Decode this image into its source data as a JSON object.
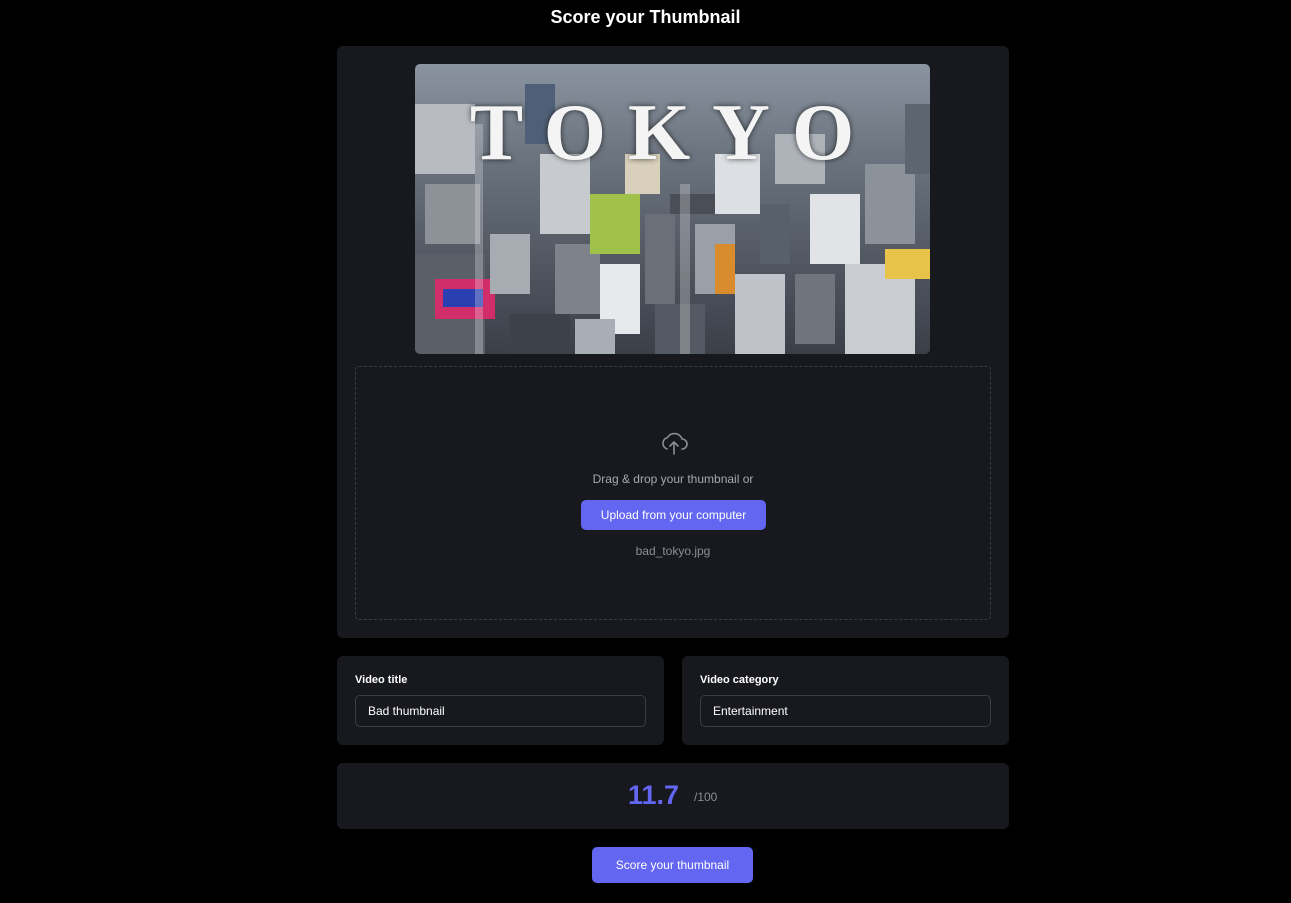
{
  "page": {
    "title": "Score your Thumbnail"
  },
  "thumbnail": {
    "overlay_text": "TOKYO"
  },
  "upload": {
    "drop_text": "Drag & drop your thumbnail or",
    "button_label": "Upload from your computer",
    "file_name": "bad_tokyo.jpg",
    "icon": "cloud-upload-icon"
  },
  "video_title": {
    "label": "Video title",
    "value": "Bad thumbnail"
  },
  "video_category": {
    "label": "Video category",
    "value": "Entertainment"
  },
  "score": {
    "value": "11.7",
    "max": "/100"
  },
  "actions": {
    "score_label": "Score your thumbnail"
  },
  "colors": {
    "accent": "#6366f1",
    "panel": "#18191e",
    "background": "#000000"
  }
}
